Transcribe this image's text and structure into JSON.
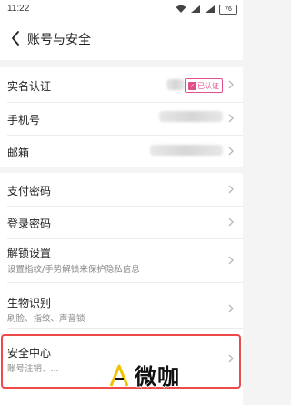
{
  "status_bar": {
    "time": "11:22",
    "battery": "76"
  },
  "header": {
    "title": "账号与安全"
  },
  "rows": {
    "real_name": {
      "label": "实名认证",
      "badge": "已认证"
    },
    "phone": {
      "label": "手机号"
    },
    "email": {
      "label": "邮箱"
    },
    "pay_password": {
      "label": "支付密码"
    },
    "login_password": {
      "label": "登录密码"
    },
    "unlock": {
      "label": "解锁设置",
      "sub": "设置指纹/手势解锁来保护隐私信息"
    },
    "biometric": {
      "label": "生物识别",
      "sub": "刷脸、指纹、声音锁"
    },
    "security_center": {
      "label": "安全中心",
      "sub": "账号注销、..."
    }
  },
  "watermark": {
    "text": "微咖"
  },
  "colors": {
    "highlight": "#ee4a4a",
    "badge": "#e0508a",
    "background": "#f4f4f4"
  }
}
